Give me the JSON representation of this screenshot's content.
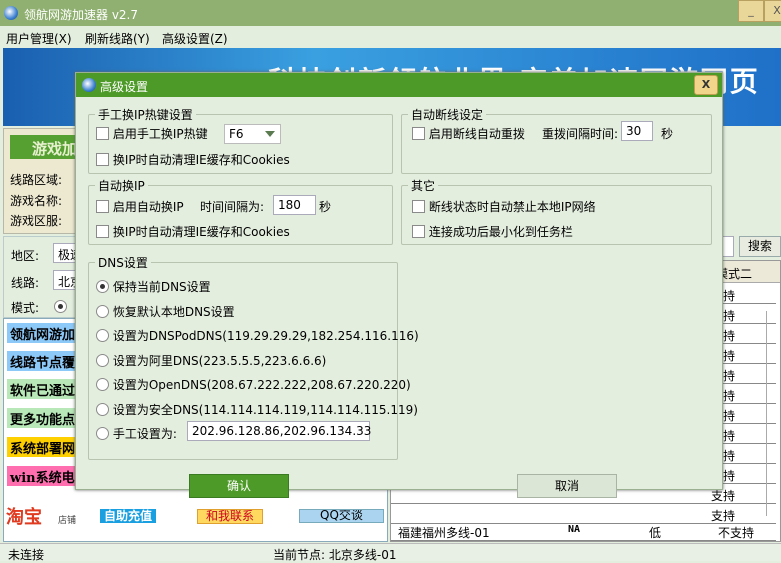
{
  "window": {
    "title": "领航网游加速器 v2.7",
    "minimize": "_",
    "close": "X"
  },
  "menu": [
    "用户管理(X)",
    "刷新线路(Y)",
    "高级设置(Z)"
  ],
  "banner": {
    "slogan": "科技创新领航业界 完美加速网游网页"
  },
  "left": {
    "game_header": "游戏加速",
    "labels": [
      "线路区域:",
      "游戏名称:",
      "游戏区服:"
    ],
    "region_label": "地区:",
    "region_value": "极速",
    "line_label": "线路:",
    "line_value": "北京",
    "mode_label": "模式:"
  },
  "ads": [
    {
      "text": "领航网游加速器",
      "color": "#8cc8f8"
    },
    {
      "text": "线路节点覆盖",
      "color": "#8cc8f8"
    },
    {
      "text": "软件已通过",
      "color": "#b8e8b8"
    },
    {
      "text": "更多功能点",
      "color": "#b8e8b8"
    },
    {
      "text": "系统部署网",
      "color": "#ffd000"
    },
    {
      "text": "win系统电",
      "color": "#ff6fb0"
    }
  ],
  "taobao": {
    "logo": "淘宝",
    "sub": "店铺",
    "buttons": [
      "自助充值",
      "和我联系",
      "QQ交谈"
    ]
  },
  "search": {
    "button": "搜索"
  },
  "table": {
    "header": "模式二",
    "rows": [
      "支持",
      "支持",
      "支持",
      "支持",
      "支持",
      "支持",
      "支持",
      "支持",
      "支持",
      "支持",
      "支持",
      "支持"
    ],
    "last_row": {
      "name": "福建福州多线-01",
      "ping": "NA",
      "load": "低",
      "mode2": "不支持"
    }
  },
  "status": {
    "left": "未连接",
    "node": "当前节点: 北京多线-01"
  },
  "dialog": {
    "title": "高级设置",
    "close": "X",
    "hotkey": {
      "legend": "手工换IP热键设置",
      "enable": "启用手工换IP热键",
      "key": "F6",
      "clear": "换IP时自动清理IE缓存和Cookies"
    },
    "auto": {
      "legend": "自动换IP",
      "enable": "启用自动换IP",
      "interval_label": "时间间隔为:",
      "interval": "180",
      "unit": "秒",
      "clear": "换IP时自动清理IE缓存和Cookies"
    },
    "reconnect": {
      "legend": "自动断线设定",
      "enable": "启用断线自动重拨",
      "interval_label": "重拨间隔时间:",
      "interval": "30",
      "unit": "秒"
    },
    "other": {
      "legend": "其它",
      "items": [
        "断线状态时自动禁止本地IP网络",
        "连接成功后最小化到任务栏"
      ]
    },
    "dns": {
      "legend": "DNS设置",
      "options": [
        "保持当前DNS设置",
        "恢复默认本地DNS设置",
        "设置为DNSPodDNS(119.29.29.29,182.254.116.116)",
        "设置为阿里DNS(223.5.5.5,223.6.6.6)",
        "设置为OpenDNS(208.67.222.222,208.67.220.220)",
        "设置为安全DNS(114.114.114.119,114.114.115.119)",
        "手工设置为:"
      ],
      "selected": 0,
      "manual_value": "202.96.128.86,202.96.134.33"
    },
    "ok": "确认",
    "cancel": "取消"
  }
}
